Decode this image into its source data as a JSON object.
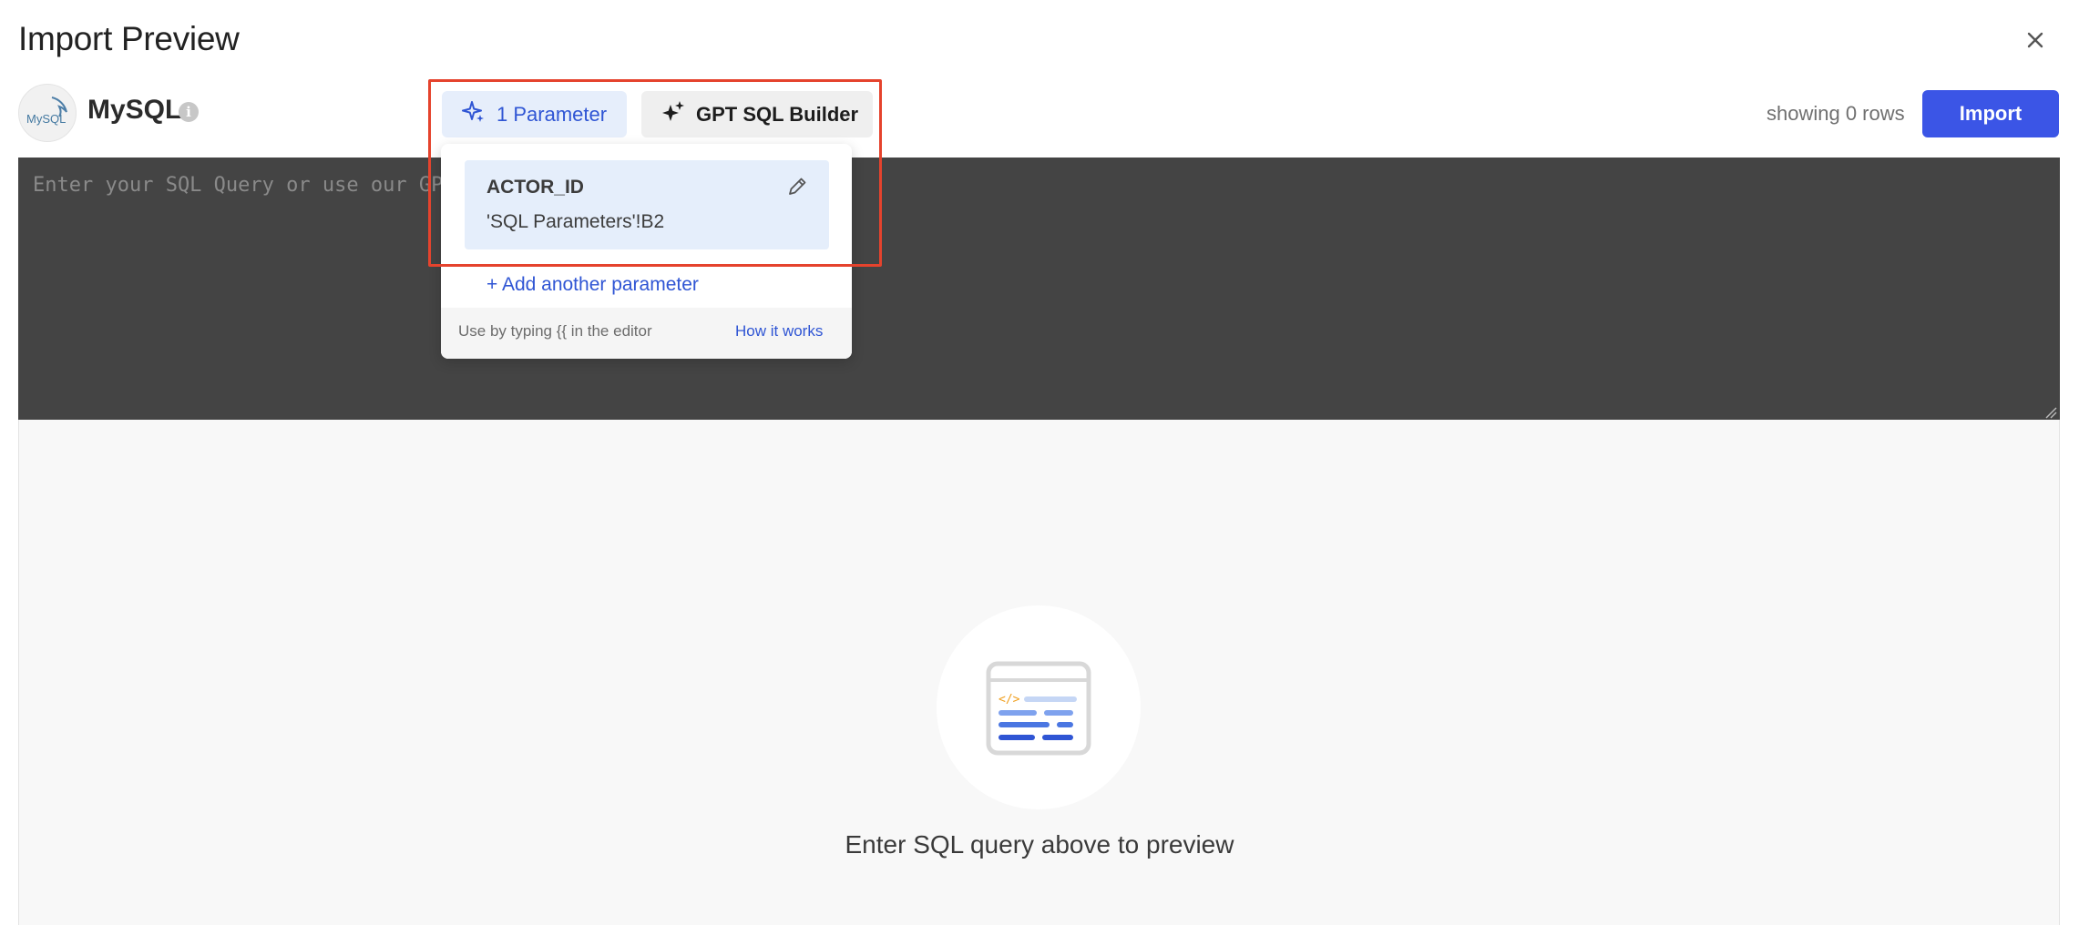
{
  "header": {
    "title": "Import Preview",
    "close_icon": "close-icon"
  },
  "source": {
    "name": "MySQL",
    "logo_text": "MySQL",
    "info_glyph": "i"
  },
  "toolbar": {
    "parameter_label": "1 Parameter",
    "gpt_label": "GPT SQL Builder",
    "rows_status": "showing 0 rows",
    "import_label": "Import"
  },
  "editor": {
    "placeholder": "Enter your SQL Query or use our GPT SQL Builder",
    "value": ""
  },
  "parameters_dropdown": {
    "items": [
      {
        "name": "ACTOR_ID",
        "value": "'SQL Parameters'!B2"
      }
    ],
    "add_label": "+ Add another parameter",
    "hint": "Use by typing {{ in the editor",
    "help_link": "How it works"
  },
  "preview": {
    "empty_message": "Enter SQL query above to preview"
  },
  "colors": {
    "accent": "#3b55e6",
    "link": "#2f55d4",
    "editor_bg": "#444444",
    "highlight": "#e5432d"
  }
}
